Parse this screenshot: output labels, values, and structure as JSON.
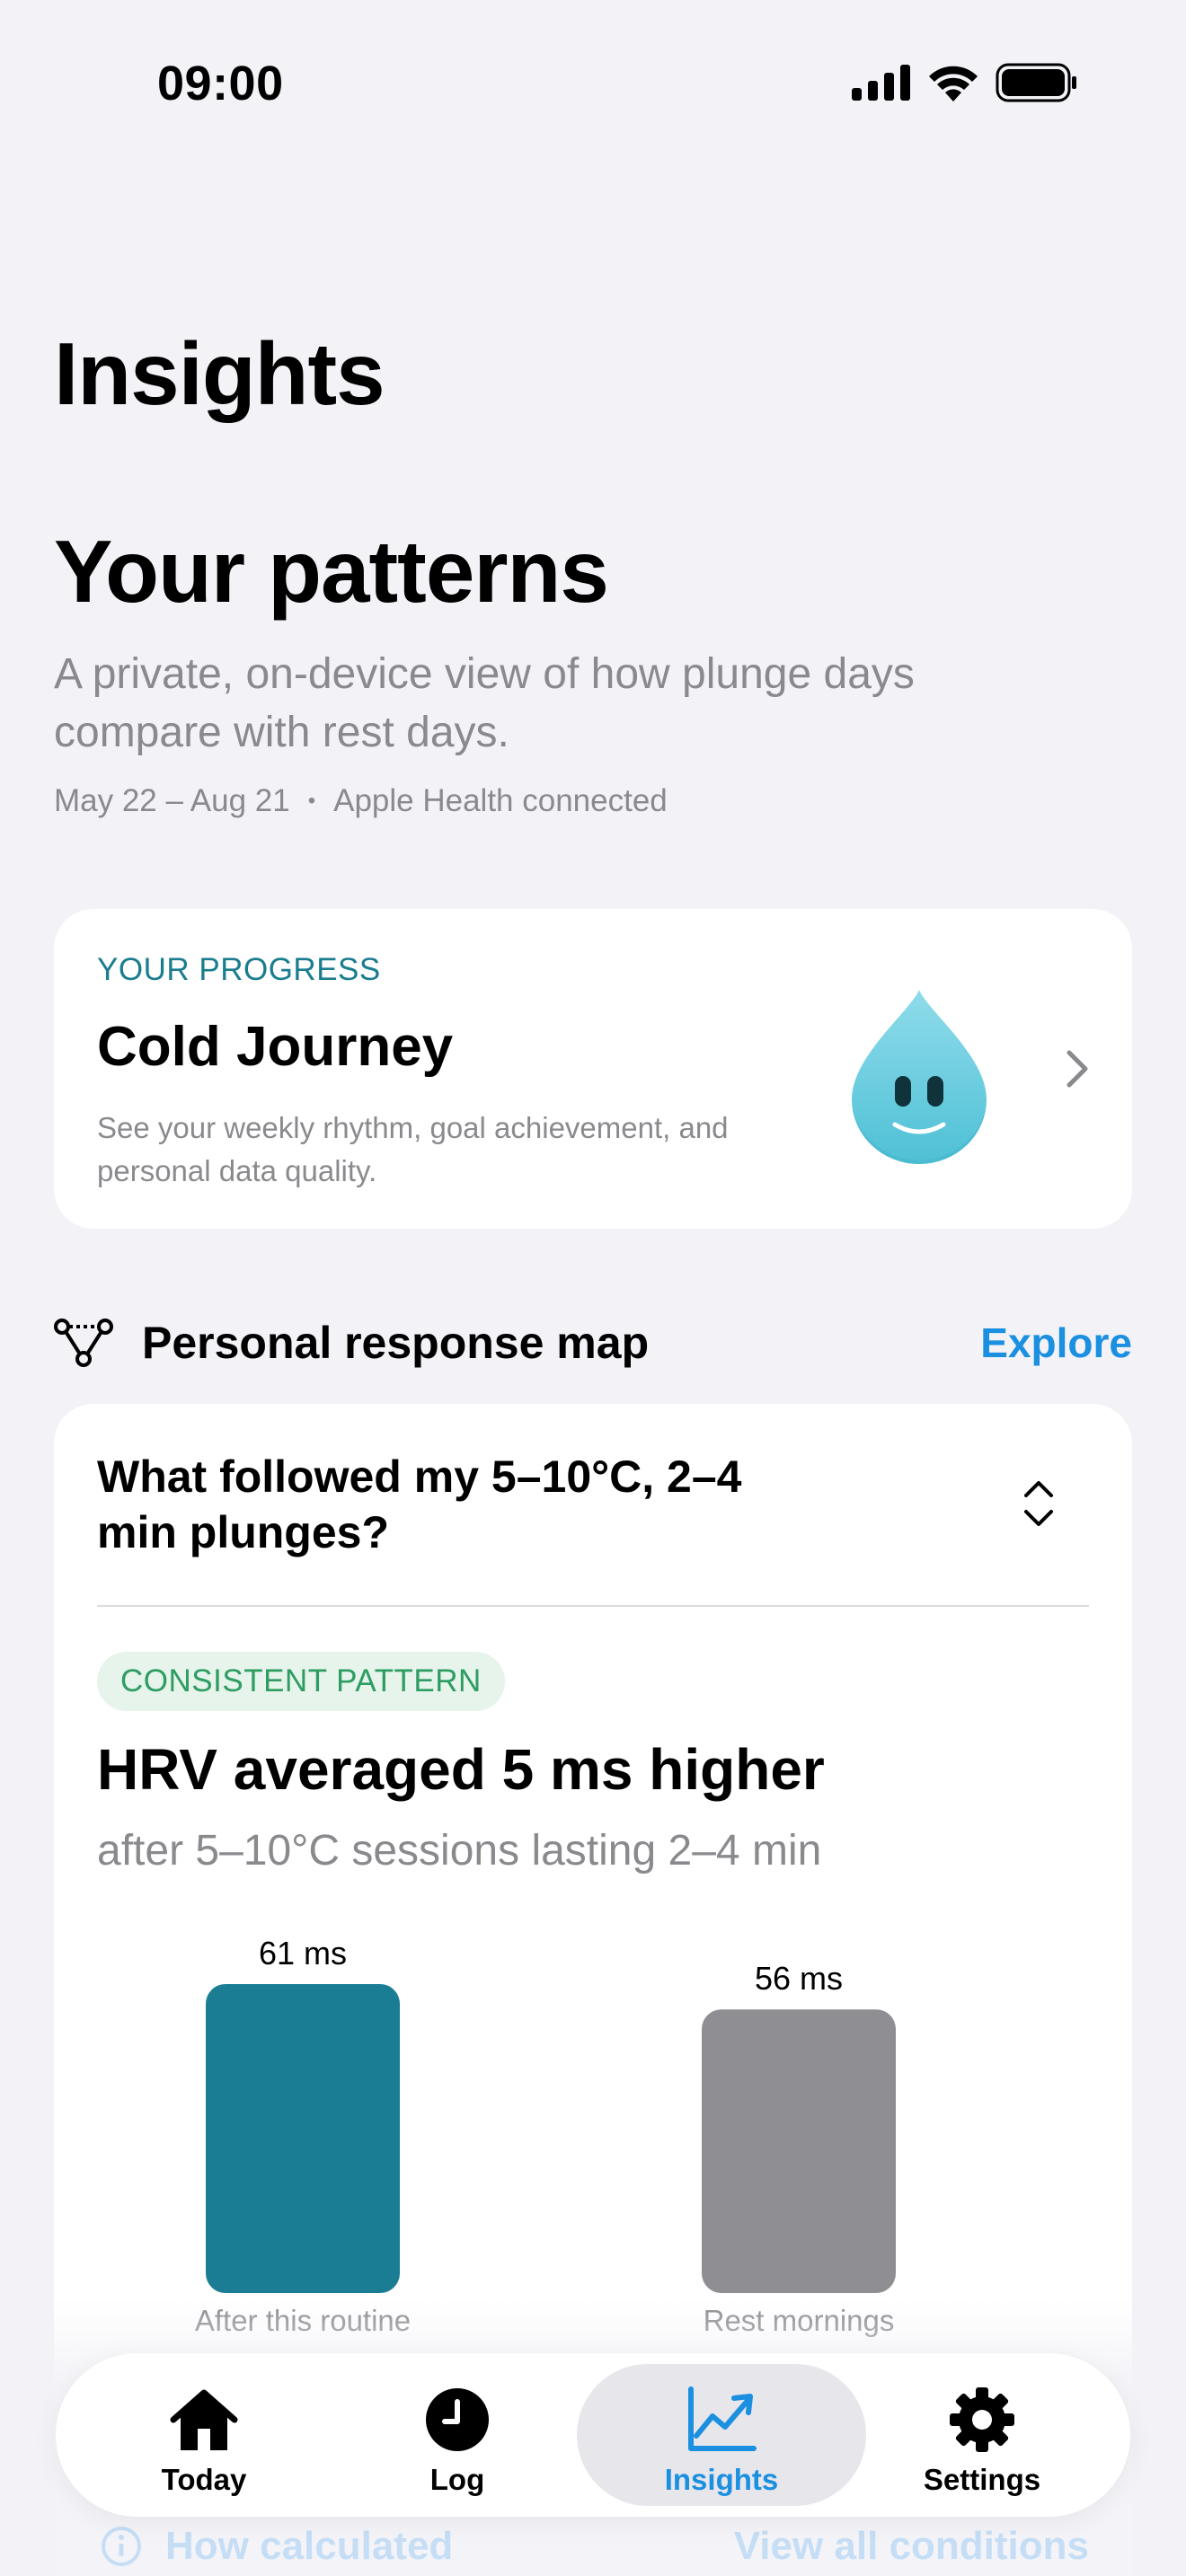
{
  "status_bar": {
    "time": "09:00",
    "icons": [
      "cellular-signal-icon",
      "wifi-icon",
      "battery-icon"
    ]
  },
  "header": {
    "title": "Insights"
  },
  "hero": {
    "title": "Your patterns",
    "subtitle": "A private, on-device view of how plunge days compare with rest days.",
    "date_range": "May 22 – Aug 21",
    "separator": "•",
    "health_status": "Apple Health connected"
  },
  "progress_card": {
    "eyebrow": "YOUR PROGRESS",
    "title": "Cold Journey",
    "description": "See your weekly rhythm, goal achievement, and personal data quality.",
    "mascot": "water-drop-mascot",
    "chevron": "chevron-right-icon"
  },
  "response_map": {
    "title": "Personal response map",
    "explore_label": "Explore",
    "question": "What followed my 5–10°C, 2–4 min plunges?",
    "badge": "CONSISTENT PATTERN",
    "result_title": "HRV averaged 5 ms higher",
    "result_subtitle": "after 5–10°C sessions lasting 2–4 min"
  },
  "chart_data": {
    "type": "bar",
    "categories": [
      "After this routine",
      "Rest mornings"
    ],
    "values": [
      61,
      56
    ],
    "value_labels": [
      "61 ms",
      "56 ms"
    ],
    "unit": "ms",
    "colors": [
      "#1a7d94",
      "#8e8e93"
    ]
  },
  "footer_links": {
    "how_calculated": "How calculated",
    "view_all": "View all conditions"
  },
  "tab_bar": {
    "tabs": [
      {
        "label": "Today",
        "icon": "house-icon"
      },
      {
        "label": "Log",
        "icon": "clock-icon"
      },
      {
        "label": "Insights",
        "icon": "chart-line-icon",
        "active": true
      },
      {
        "label": "Settings",
        "icon": "gear-icon"
      }
    ],
    "active_color": "#1b8fe0"
  },
  "colors": {
    "accent": "#1b8fe0",
    "teal": "#1a7d8f",
    "badge_green": "#2e9d61"
  }
}
